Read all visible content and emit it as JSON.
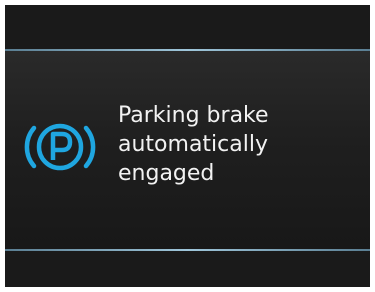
{
  "alert": {
    "icon": "parking-brake-icon",
    "icon_color": "#1fa6e0",
    "message_lines": [
      "Parking brake",
      "automatically",
      "engaged"
    ]
  }
}
